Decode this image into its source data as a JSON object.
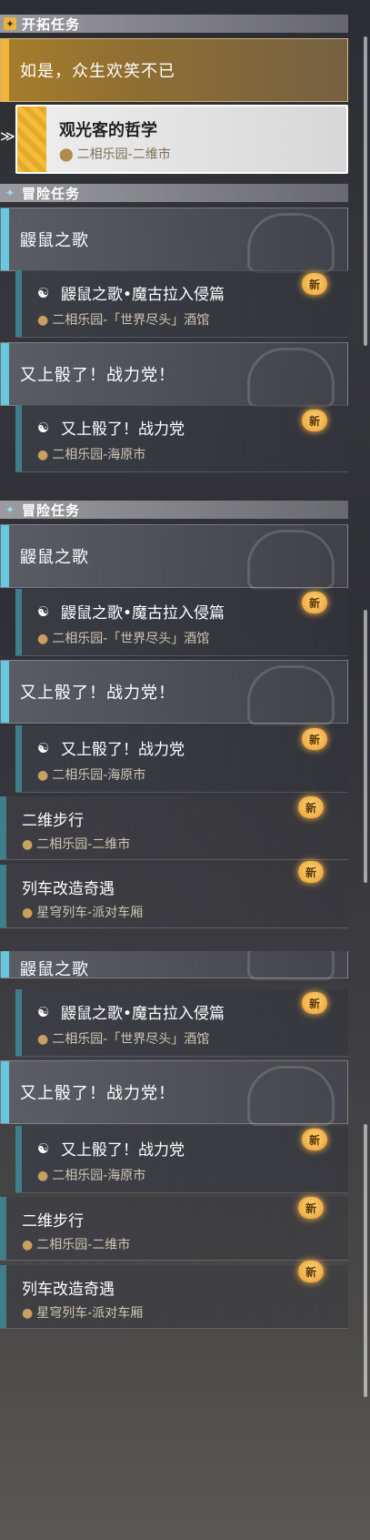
{
  "panel1": {
    "header_trailblaze": "开拓任务",
    "trailblaze_main": "如是，众生欢笑不已",
    "trailblaze_selected": {
      "title": "观光客的哲学",
      "location": "二相乐园-二维市"
    },
    "header_adventure": "冒险任务",
    "adv_main_1": "鼹鼠之歌",
    "adv_sub_1": {
      "title": "鼹鼠之歌•魔古拉入侵篇",
      "location": "二相乐园-「世界尽头」酒馆",
      "badge": "新"
    },
    "adv_main_2": "又上骰了！战力党！",
    "adv_sub_2": {
      "title": "又上骰了！战力党",
      "location": "二相乐园-海原市",
      "badge": "新"
    }
  },
  "panel2": {
    "header_adventure": "冒险任务",
    "adv_main_1": "鼹鼠之歌",
    "adv_sub_1": {
      "title": "鼹鼠之歌•魔古拉入侵篇",
      "location": "二相乐园-「世界尽头」酒馆",
      "badge": "新"
    },
    "adv_main_2": "又上骰了！战力党！",
    "adv_sub_2": {
      "title": "又上骰了！战力党",
      "location": "二相乐园-海原市",
      "badge": "新"
    },
    "plain_1": {
      "title": "二维步行",
      "location": "二相乐园-二维市",
      "badge": "新"
    },
    "plain_2": {
      "title": "列车改造奇遇",
      "location": "星穹列车-派对车厢",
      "badge": "新"
    }
  },
  "panel3": {
    "adv_main_1_partial": "鼹鼠之歌",
    "adv_sub_1": {
      "title": "鼹鼠之歌•魔古拉入侵篇",
      "location": "二相乐园-「世界尽头」酒馆",
      "badge": "新"
    },
    "adv_main_2": "又上骰了！战力党！",
    "adv_sub_2": {
      "title": "又上骰了！战力党",
      "location": "二相乐园-海原市",
      "badge": "新"
    },
    "plain_1": {
      "title": "二维步行",
      "location": "二相乐园-二维市",
      "badge": "新"
    },
    "plain_2": {
      "title": "列车改造奇遇",
      "location": "星穹列车-派对车厢",
      "badge": "新"
    }
  },
  "icons": {
    "location": "map-pin-icon",
    "quest": "puzzle-quest-icon",
    "new": "new-badge-icon"
  },
  "colors": {
    "gold": "#f0b43a",
    "cyan": "#67c7de",
    "teal": "#3f7f8c",
    "badge": "#ffb640"
  }
}
